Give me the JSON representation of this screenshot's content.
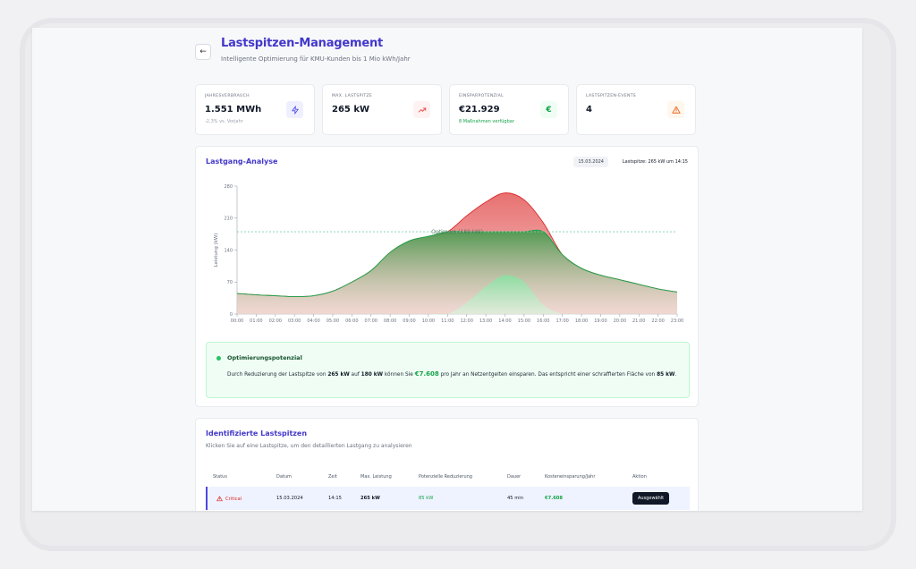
{
  "header": {
    "title": "Lastspitzen-Management",
    "subtitle": "Intelligente Optimierung für KMU-Kunden bis 1 Mio kWh/Jahr"
  },
  "kpis": [
    {
      "label": "JAHRESVERBRAUCH",
      "value": "1.551 MWh",
      "sub": "-2,3% vs. Vorjahr",
      "icon": "lightning-icon",
      "icon_color": "#4f46e5",
      "icon_bg": "#eef0ff"
    },
    {
      "label": "MAX. LASTSPITZE",
      "value": "265 kW",
      "sub": "",
      "icon": "trend-up-icon",
      "icon_color": "#ef4444",
      "icon_bg": "#fef2f2"
    },
    {
      "label": "EINSPARPOTENZIAL",
      "value": "€21.929",
      "sub": "8 Maßnahmen verfügbar",
      "icon": "euro-icon",
      "icon_color": "#16a34a",
      "icon_bg": "#f0fdf4"
    },
    {
      "label": "LASTSPITZEN-EVENTS",
      "value": "4",
      "sub": "",
      "icon": "warning-icon",
      "icon_color": "#ea580c",
      "icon_bg": "#fff7ed"
    }
  ],
  "analysis": {
    "title": "Lastgang-Analyse",
    "date": "15.03.2024",
    "peak_info": "Lastspitze: 265 kW um 14:15",
    "optimization": {
      "title": "Optimierungspotenzial",
      "text_1": "Durch Reduzierung der Lastspitze von ",
      "peak": "265 kW",
      "text_2": " auf ",
      "target": "180 kW",
      "text_3": " können Sie ",
      "savings": "€7.608",
      "text_4": " pro Jahr an Netzentgelten einsparen. Das entspricht einer schraffierten Fläche von ",
      "area": "85 kW",
      "text_5": "."
    }
  },
  "chart_data": {
    "type": "area",
    "ylabel": "Leistung (kW)",
    "ylim": [
      0,
      280
    ],
    "yticks": [
      "0",
      "70",
      "140",
      "210",
      "280"
    ],
    "x": [
      "00:00",
      "01:00",
      "02:00",
      "03:00",
      "04:00",
      "05:00",
      "06:00",
      "07:00",
      "08:00",
      "09:00",
      "10:00",
      "11:00",
      "12:00",
      "13:00",
      "14:00",
      "15:00",
      "16:00",
      "17:00",
      "18:00",
      "19:00",
      "20:00",
      "21:00",
      "22:00",
      "23:00"
    ],
    "threshold": {
      "value": 180,
      "label": "Optimum (180 kW)"
    },
    "series": [
      {
        "values": [
          45,
          42,
          40,
          38,
          40,
          50,
          70,
          95,
          135,
          160,
          170,
          180,
          215,
          245,
          265,
          250,
          200,
          130,
          100,
          85,
          75,
          65,
          55,
          48
        ]
      },
      {
        "values": [
          0,
          0,
          0,
          0,
          0,
          0,
          0,
          0,
          0,
          0,
          0,
          0,
          25,
          60,
          85,
          70,
          20,
          0,
          0,
          0,
          0,
          0,
          0,
          0
        ]
      }
    ],
    "colors": {
      "green": "#22a34a",
      "red": "#e05252",
      "threshold": "#7ccfb0"
    }
  },
  "table": {
    "title": "Identifizierte Lastspitzen",
    "subtitle": "Klicken Sie auf eine Lastspitze, um den detaillierten Lastgang zu analysieren",
    "headers": [
      "Status",
      "Datum",
      "Zeit",
      "Max. Leistung",
      "Potenzielle Reduzierung",
      "Dauer",
      "Kosteneinsparung/Jahr",
      "Aktion"
    ],
    "rows": [
      {
        "status": "Critical",
        "date": "15.03.2024",
        "time": "14:15",
        "max": "265 kW",
        "reduction": "85 kW",
        "duration": "45 min",
        "savings": "€7.608",
        "action": "Ausgewählt"
      }
    ]
  }
}
